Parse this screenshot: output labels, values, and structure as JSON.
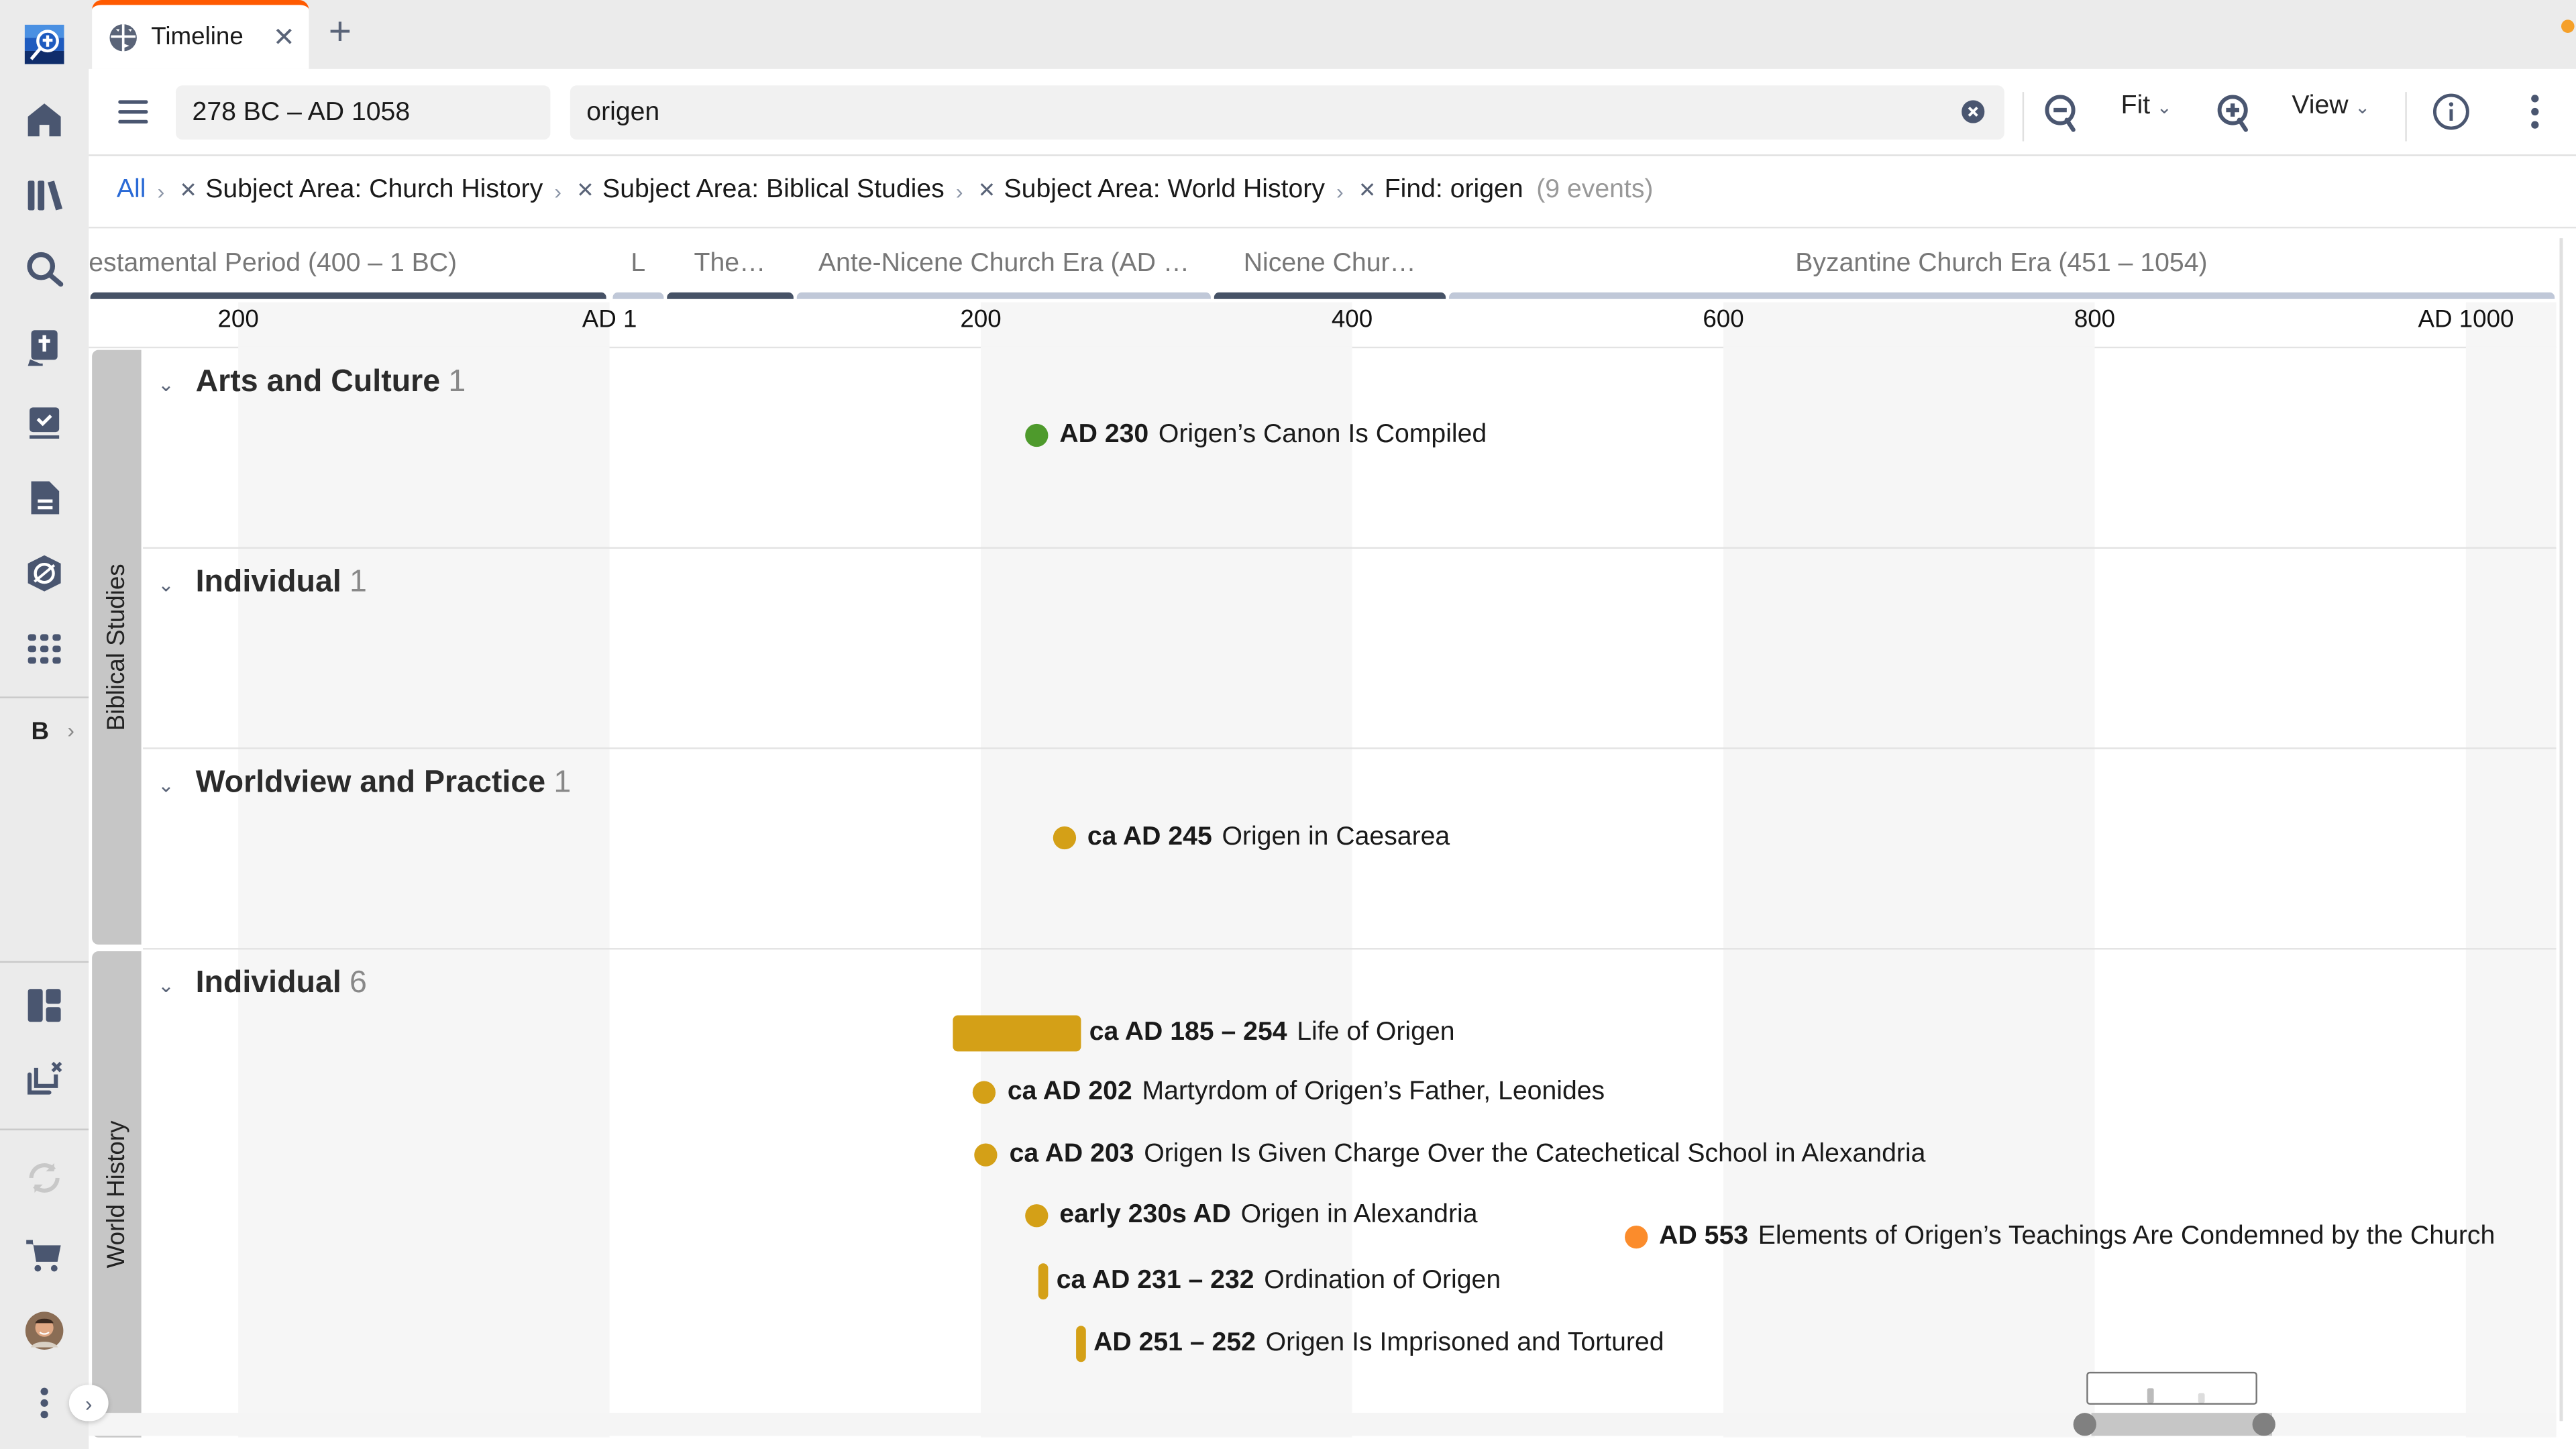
{
  "tab": {
    "title": "Timeline",
    "icon": "timeline-icon"
  },
  "toolbar": {
    "range": "278 BC – AD 1058",
    "search_value": "origen",
    "fit_label": "Fit",
    "view_label": "View"
  },
  "breadcrumb": {
    "all": "All",
    "filters": [
      "Subject Area: Church History",
      "Subject Area: Biblical Studies",
      "Subject Area: World History",
      "Find: origen"
    ],
    "count": "(9 events)"
  },
  "eras": [
    {
      "label": "estamental Period (400 – 1 BC)",
      "start": -400,
      "end": -1,
      "dark": true
    },
    {
      "label": "L",
      "start": 1,
      "end": 30,
      "dark": false
    },
    {
      "label": "The…",
      "start": 30,
      "end": 100,
      "dark": true
    },
    {
      "label": "Ante-Nicene Church Era (AD …",
      "start": 100,
      "end": 325,
      "dark": false
    },
    {
      "label": "Nicene Chur…",
      "start": 325,
      "end": 451,
      "dark": true
    },
    {
      "label": "Byzantine Church Era (451 – 1054)",
      "start": 451,
      "end": 1054,
      "dark": false
    }
  ],
  "axis": {
    "ticks": [
      {
        "year": -200,
        "label": "200"
      },
      {
        "year": 0,
        "label": "AD 1"
      },
      {
        "year": 200,
        "label": "200"
      },
      {
        "year": 400,
        "label": "400"
      },
      {
        "year": 600,
        "label": "600"
      },
      {
        "year": 800,
        "label": "800"
      },
      {
        "year": 1000,
        "label": "AD 1000"
      }
    ]
  },
  "subject_areas": [
    {
      "label": "Biblical Studies",
      "categories": [
        {
          "name": "Arts and Culture",
          "count": "1",
          "events": [
            {
              "date": "AD 230",
              "title": "Origen’s Canon Is Compiled",
              "start": 230,
              "end": 230,
              "color": "#4e9a2c",
              "shape": "dot"
            }
          ]
        },
        {
          "name": "Individual",
          "count": "1",
          "events": [
            {
              "date": "ca AD 245",
              "title": "Origen in Caesarea",
              "start": 245,
              "end": 245,
              "color": "#d4a017",
              "shape": "dot"
            }
          ]
        },
        {
          "name": "Worldview and Practice",
          "count": "1",
          "events": [
            {
              "date": "AD 553",
              "title": "Elements of Origen’s Teachings Are Condemned by the Church",
              "start": 553,
              "end": 553,
              "color": "#fb8c2c",
              "shape": "dot"
            }
          ]
        }
      ]
    },
    {
      "label": "World History",
      "categories": [
        {
          "name": "Individual",
          "count": "6",
          "events": [
            {
              "date": "ca AD 185 – 254",
              "title": "Life of Origen",
              "start": 185,
              "end": 254,
              "color": "#d4a017",
              "shape": "bar"
            },
            {
              "date": "ca AD 202",
              "title": "Martyrdom of Origen’s Father, Leonides",
              "start": 202,
              "end": 202,
              "color": "#d4a017",
              "shape": "dot"
            },
            {
              "date": "ca AD 203",
              "title": "Origen Is Given Charge Over the Catechetical School in Alexandria",
              "start": 203,
              "end": 203,
              "color": "#d4a017",
              "shape": "dot"
            },
            {
              "date": "early 230s AD",
              "title": "Origen in Alexandria",
              "start": 230,
              "end": 230,
              "color": "#d4a017",
              "shape": "dot"
            },
            {
              "date": "ca AD 231 – 232",
              "title": "Ordination of Origen",
              "start": 231,
              "end": 232,
              "color": "#d4a017",
              "shape": "bar"
            },
            {
              "date": "AD 251 – 252",
              "title": "Origen Is Imprisoned and Tortured",
              "start": 251,
              "end": 252,
              "color": "#d4a017",
              "shape": "bar"
            }
          ]
        }
      ]
    }
  ],
  "rail": {
    "items": [
      "app-logo-icon",
      "home-icon",
      "library-icon",
      "search-icon",
      "bible-icon",
      "reading-plan-icon",
      "document-icon",
      "guides-icon",
      "tools-grid-icon"
    ],
    "bottom": [
      "layouts-icon",
      "close-panels-icon",
      "sync-icon",
      "cart-icon",
      "avatar",
      "more-icon"
    ],
    "b_label": "B"
  },
  "colors": {
    "accent": "#ff5a00",
    "link": "#2a6ad6",
    "icon": "#4a5670"
  }
}
